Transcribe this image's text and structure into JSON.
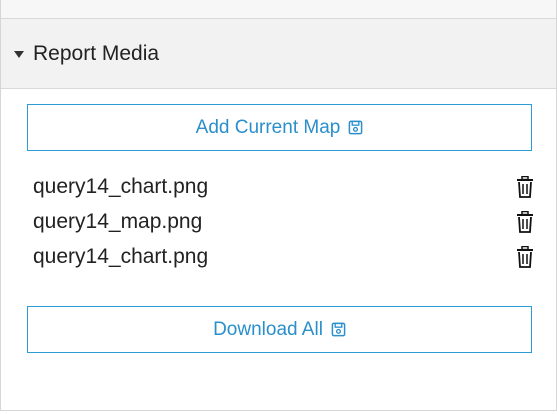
{
  "section": {
    "title": "Report Media"
  },
  "add_button": {
    "label": "Add Current Map",
    "icon": "save-icon"
  },
  "files": [
    {
      "name": "query14_chart.png",
      "icon": "trash-icon"
    },
    {
      "name": "query14_map.png",
      "icon": "trash-icon"
    },
    {
      "name": "query14_chart.png",
      "icon": "trash-icon"
    }
  ],
  "download_button": {
    "label": "Download All",
    "icon": "save-icon"
  },
  "colors": {
    "accent": "#2c9bd6",
    "header_bg": "#f2f2f2",
    "border": "#d9d9d9"
  }
}
